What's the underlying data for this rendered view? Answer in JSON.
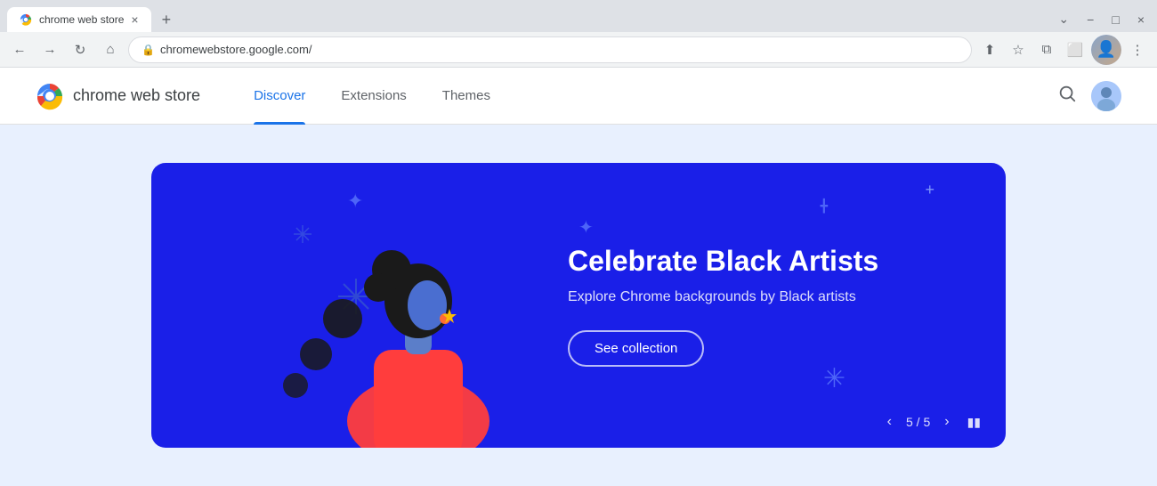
{
  "browser": {
    "tab_title": "chrome web store",
    "tab_favicon": "🌐",
    "new_tab_icon": "+",
    "url": "chromewebstore.google.com/",
    "window_controls": {
      "minimize": "−",
      "maximize": "□",
      "close": "×"
    },
    "nav": {
      "back_disabled": false,
      "forward_disabled": false,
      "reload": "↻",
      "home": "⌂"
    }
  },
  "store": {
    "logo_alt": "Chrome logo",
    "name": "chrome web store",
    "nav_links": [
      {
        "id": "discover",
        "label": "Discover",
        "active": true
      },
      {
        "id": "extensions",
        "label": "Extensions",
        "active": false
      },
      {
        "id": "themes",
        "label": "Themes",
        "active": false
      }
    ],
    "search_icon": "🔍",
    "avatar_alt": "User avatar"
  },
  "banner": {
    "title": "Celebrate Black Artists",
    "subtitle": "Explore Chrome backgrounds by Black artists",
    "cta_label": "See collection",
    "pagination": {
      "current": 5,
      "total": 5,
      "text": "5 / 5"
    }
  }
}
